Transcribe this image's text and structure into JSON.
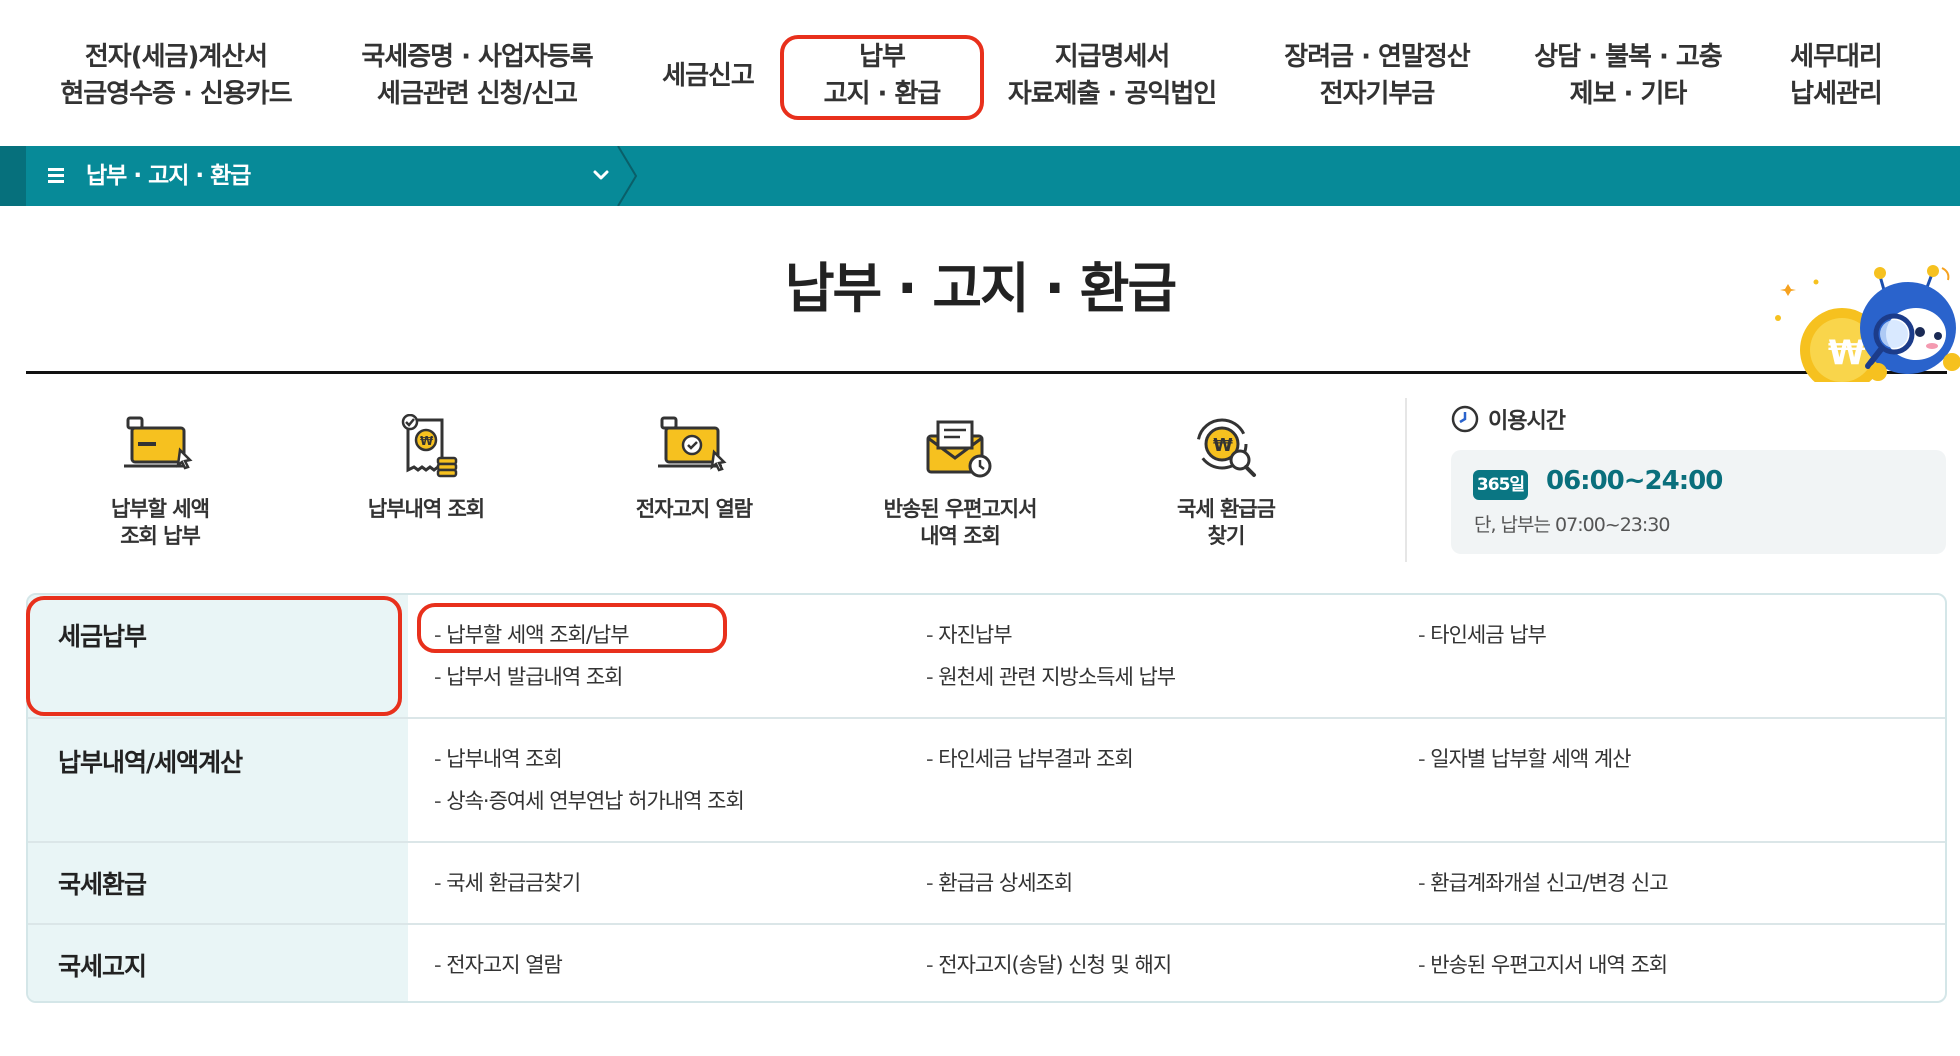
{
  "topnav": {
    "items": [
      {
        "line1": "전자(세금)계산서",
        "line2": "현금영수증 · 신용카드"
      },
      {
        "line1": "국세증명 · 사업자등록",
        "line2": "세금관련 신청/신고"
      },
      {
        "line1": "세금신고",
        "line2": ""
      },
      {
        "line1": "납부",
        "line2": "고지 · 환급"
      },
      {
        "line1": "지급명세서",
        "line2": "자료제출 · 공익법인"
      },
      {
        "line1": "장려금 · 연말정산",
        "line2": "전자기부금"
      },
      {
        "line1": "상담 · 불복 · 고충",
        "line2": "제보 · 기타"
      },
      {
        "line1": "세무대리",
        "line2": "납세관리"
      }
    ]
  },
  "breadcrumb": {
    "label": "납부 · 고지 · 환급"
  },
  "page": {
    "title": "납부 · 고지 · 환급"
  },
  "quick": [
    {
      "line1": "납부할 세액",
      "line2": "조회 납부",
      "icon": "laptop-payment-icon"
    },
    {
      "line1": "납부내역 조회",
      "line2": "",
      "icon": "receipt-coins-icon"
    },
    {
      "line1": "전자고지 열람",
      "line2": "",
      "icon": "laptop-check-icon"
    },
    {
      "line1": "반송된 우편고지서",
      "line2": "내역 조회",
      "icon": "returned-mail-icon"
    },
    {
      "line1": "국세 환급금",
      "line2": "찾기",
      "icon": "refund-search-icon"
    }
  ],
  "hours": {
    "title": "이용시간",
    "badge": "365일",
    "time": "06:00~24:00",
    "note": "단, 납부는 07:00~23:30"
  },
  "menu": [
    {
      "category": "세금납부",
      "links": [
        "납부할 세액 조회/납부",
        "자진납부",
        "타인세금 납부",
        "납부서 발급내역 조회",
        "원천세 관련 지방소득세 납부"
      ]
    },
    {
      "category": "납부내역/세액계산",
      "links": [
        "납부내역 조회",
        "타인세금 납부결과 조회",
        "일자별 납부할 세액 계산",
        "상속·증여세 연부연납 허가내역 조회"
      ]
    },
    {
      "category": "국세환급",
      "links": [
        "국세 환급금찾기",
        "환급금 상세조회",
        "환급계좌개설 신고/변경 신고"
      ]
    },
    {
      "category": "국세고지",
      "links": [
        "전자고지 열람",
        "전자고지(송달) 신청 및 해지",
        "반송된 우편고지서 내역 조회"
      ]
    }
  ],
  "colors": {
    "accent": "#078a98",
    "highlight": "#e8301c",
    "category_bg": "#e9f5f6",
    "icon_yellow": "#f6c11f"
  }
}
